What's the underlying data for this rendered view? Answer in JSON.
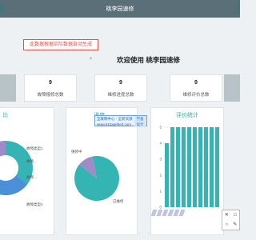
{
  "header": {
    "title": "桃李园速修"
  },
  "notice": {
    "text": "此数据根据实际数据自动生成"
  },
  "welcome": {
    "text": "欢迎使用 桃李园速修"
  },
  "stats": [
    {
      "value": "9",
      "label": "故障报修总数"
    },
    {
      "value": "9",
      "label": "维修进度总数"
    },
    {
      "value": "9",
      "label": "维修评价总数"
    }
  ],
  "cards": {
    "left": {
      "title": "比",
      "legend_labels": [
        "故障类型1",
        "故障...",
        "故障...",
        "故障类型4"
      ]
    },
    "middle": {
      "title": "进度...",
      "labels": [
        "维修中",
        "已维修"
      ]
    },
    "right": {
      "title": "评价统计"
    }
  },
  "watermark": {
    "line1": "互联网中心 · 全新资源",
    "line2": "www.51togetherl.com",
    "side1": "学会",
    "side2": "设计"
  },
  "toolbar_icons": [
    "close-icon",
    "square-icon",
    "circle-icon",
    "pen-icon"
  ],
  "colors": {
    "header": "#5b6f78",
    "accent": "#3aa6a8",
    "bar": "#35b4b4",
    "pie_main": "#35b4b4",
    "pie_alt": "#9f8bc8",
    "pie_blue": "#4a90d9",
    "notice_red": "#d9534f"
  },
  "chart_data": [
    {
      "type": "pie",
      "title": "比",
      "slices": [
        {
          "label": "故障类型1",
          "value": 35
        },
        {
          "label": "故障...",
          "value": 25
        },
        {
          "label": "故障...",
          "value": 20
        },
        {
          "label": "故障类型4",
          "value": 20
        }
      ]
    },
    {
      "type": "pie",
      "title": "进度...",
      "slices": [
        {
          "label": "维修中",
          "value": 1
        },
        {
          "label": "已维修",
          "value": 8
        }
      ]
    },
    {
      "type": "bar",
      "title": "评价统计",
      "ylim": [
        0,
        5
      ],
      "yticks": [
        0,
        1,
        2,
        3,
        4,
        5
      ],
      "values": [
        4,
        5,
        5,
        5,
        5,
        5,
        5,
        5,
        5,
        5
      ]
    }
  ]
}
